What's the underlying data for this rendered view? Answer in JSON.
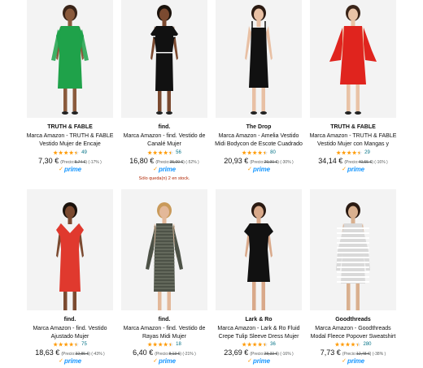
{
  "products": [
    {
      "brand": "TRUTH & FABLE",
      "title": "Marca Amazon - TRUTH & FABLE Vestido Mujer de Encaje",
      "stars": 4,
      "reviews": "49",
      "price": "7,30 €",
      "old_prefix": "Precio:",
      "old_price": "8,74 €",
      "discount": "(-17% )",
      "prime": "prime",
      "stock": "",
      "dress_color": "#1fa24a",
      "style": "lace-sleeve",
      "skin": "#8a5a3c",
      "hair": "#3a2418"
    },
    {
      "brand": "find.",
      "title": "Marca Amazon - find. Vestido de Canalé Mujer",
      "stars": 4,
      "reviews": "56",
      "price": "16,80 €",
      "old_prefix": "Precio:",
      "old_price": "35,00 €",
      "discount": "(-52% )",
      "prime": "prime",
      "stock": "Sólo queda(n) 2 en stock.",
      "dress_color": "#111111",
      "style": "short-sleeve",
      "skin": "#7b4a30",
      "hair": "#1a120c"
    },
    {
      "brand": "The Drop",
      "title": "Marca Amazon - Amelia Vestido Midi Bodycon de Escote Cuadrado y...",
      "stars": 4,
      "reviews": "80",
      "price": "20,93 €",
      "old_prefix": "Precio:",
      "old_price": "29,90 €",
      "discount": "(-30% )",
      "prime": "prime",
      "stock": "",
      "dress_color": "#111111",
      "style": "strap",
      "skin": "#e8c0a4",
      "hair": "#2a1a12"
    },
    {
      "brand": "TRUTH & FABLE",
      "title": "Marca Amazon - TRUTH & FABLE Vestido Mujer con Mangas y Volante",
      "stars": 4,
      "reviews": "29",
      "price": "34,14 €",
      "old_prefix": "Precio:",
      "old_price": "40,55 €",
      "discount": "(-16% )",
      "prime": "prime",
      "stock": "",
      "dress_color": "#e0241e",
      "style": "flare-sleeve",
      "skin": "#e9c3a6",
      "hair": "#3a2418"
    },
    {
      "brand": "find.",
      "title": "Marca Amazon - find. Vestido Ajustado Mujer",
      "stars": 4,
      "reviews": "75",
      "price": "18,63 €",
      "old_prefix": "Precio:",
      "old_price": "32,85 €",
      "discount": "(-43% )",
      "prime": "prime",
      "stock": "",
      "dress_color": "#e0392e",
      "style": "vneck",
      "skin": "#7b4a30",
      "hair": "#1a120c"
    },
    {
      "brand": "find.",
      "title": "Marca Amazon - find. Vestido de Rayas Midi Mujer",
      "stars": 4,
      "reviews": "18",
      "price": "6,40 €",
      "old_prefix": "Precio:",
      "old_price": "8,13 €",
      "discount": "(-21% )",
      "prime": "prime",
      "stock": "",
      "dress_color": "#4d5247",
      "style": "long-stripe",
      "skin": "#e3b899",
      "hair": "#c99a5a"
    },
    {
      "brand": "Lark & Ro",
      "title": "Marca Amazon - Lark & Ro Fluid Crepe Tulip Sleeve Dress Mujer",
      "stars": 4,
      "reviews": "36",
      "price": "23,69 €",
      "old_prefix": "Precio:",
      "old_price": "28,33 €",
      "discount": "(-16% )",
      "prime": "prime",
      "stock": "",
      "dress_color": "#111111",
      "style": "tulip",
      "skin": "#d9a98a",
      "hair": "#2a1a12"
    },
    {
      "brand": "Goodthreads",
      "title": "Marca Amazon - Goodthreads Modal Fleece Popover Sweatshirt Dres...",
      "stars": 4,
      "reviews": "280",
      "price": "7,73 €",
      "old_prefix": "Precio:",
      "old_price": "12,48 €",
      "discount": "(-38% )",
      "prime": "prime",
      "stock": "",
      "dress_color": "#d9d9d9",
      "style": "sweat-stripe",
      "skin": "#d9b08f",
      "hair": "#2a1a12"
    }
  ]
}
